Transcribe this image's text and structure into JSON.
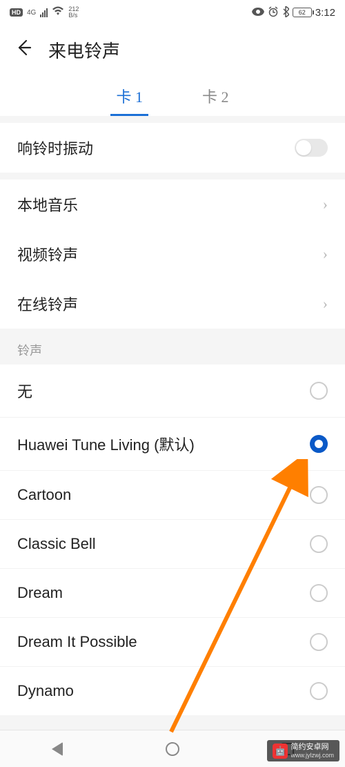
{
  "status": {
    "hd": "HD",
    "net_gen": "4G",
    "speed_value": "212",
    "speed_unit": "B/s",
    "battery": "62",
    "time": "3:12"
  },
  "header": {
    "title": "来电铃声"
  },
  "tabs": {
    "items": [
      {
        "label": "卡 1",
        "active": true
      },
      {
        "label": "卡 2",
        "active": false
      }
    ]
  },
  "vibrate": {
    "label": "响铃时振动",
    "enabled": false
  },
  "sources": {
    "items": [
      {
        "label": "本地音乐"
      },
      {
        "label": "视频铃声"
      },
      {
        "label": "在线铃声"
      }
    ]
  },
  "ringtones": {
    "section_label": "铃声",
    "items": [
      {
        "label": "无",
        "cn": true,
        "selected": false
      },
      {
        "label": "Huawei Tune Living (默认)",
        "cn": false,
        "selected": true
      },
      {
        "label": "Cartoon",
        "cn": false,
        "selected": false
      },
      {
        "label": "Classic Bell",
        "cn": false,
        "selected": false
      },
      {
        "label": "Dream",
        "cn": false,
        "selected": false
      },
      {
        "label": "Dream It Possible",
        "cn": false,
        "selected": false
      },
      {
        "label": "Dynamo",
        "cn": false,
        "selected": false
      }
    ]
  },
  "watermark": {
    "brand": "简约安卓网",
    "url": "www.jylzwj.com"
  }
}
